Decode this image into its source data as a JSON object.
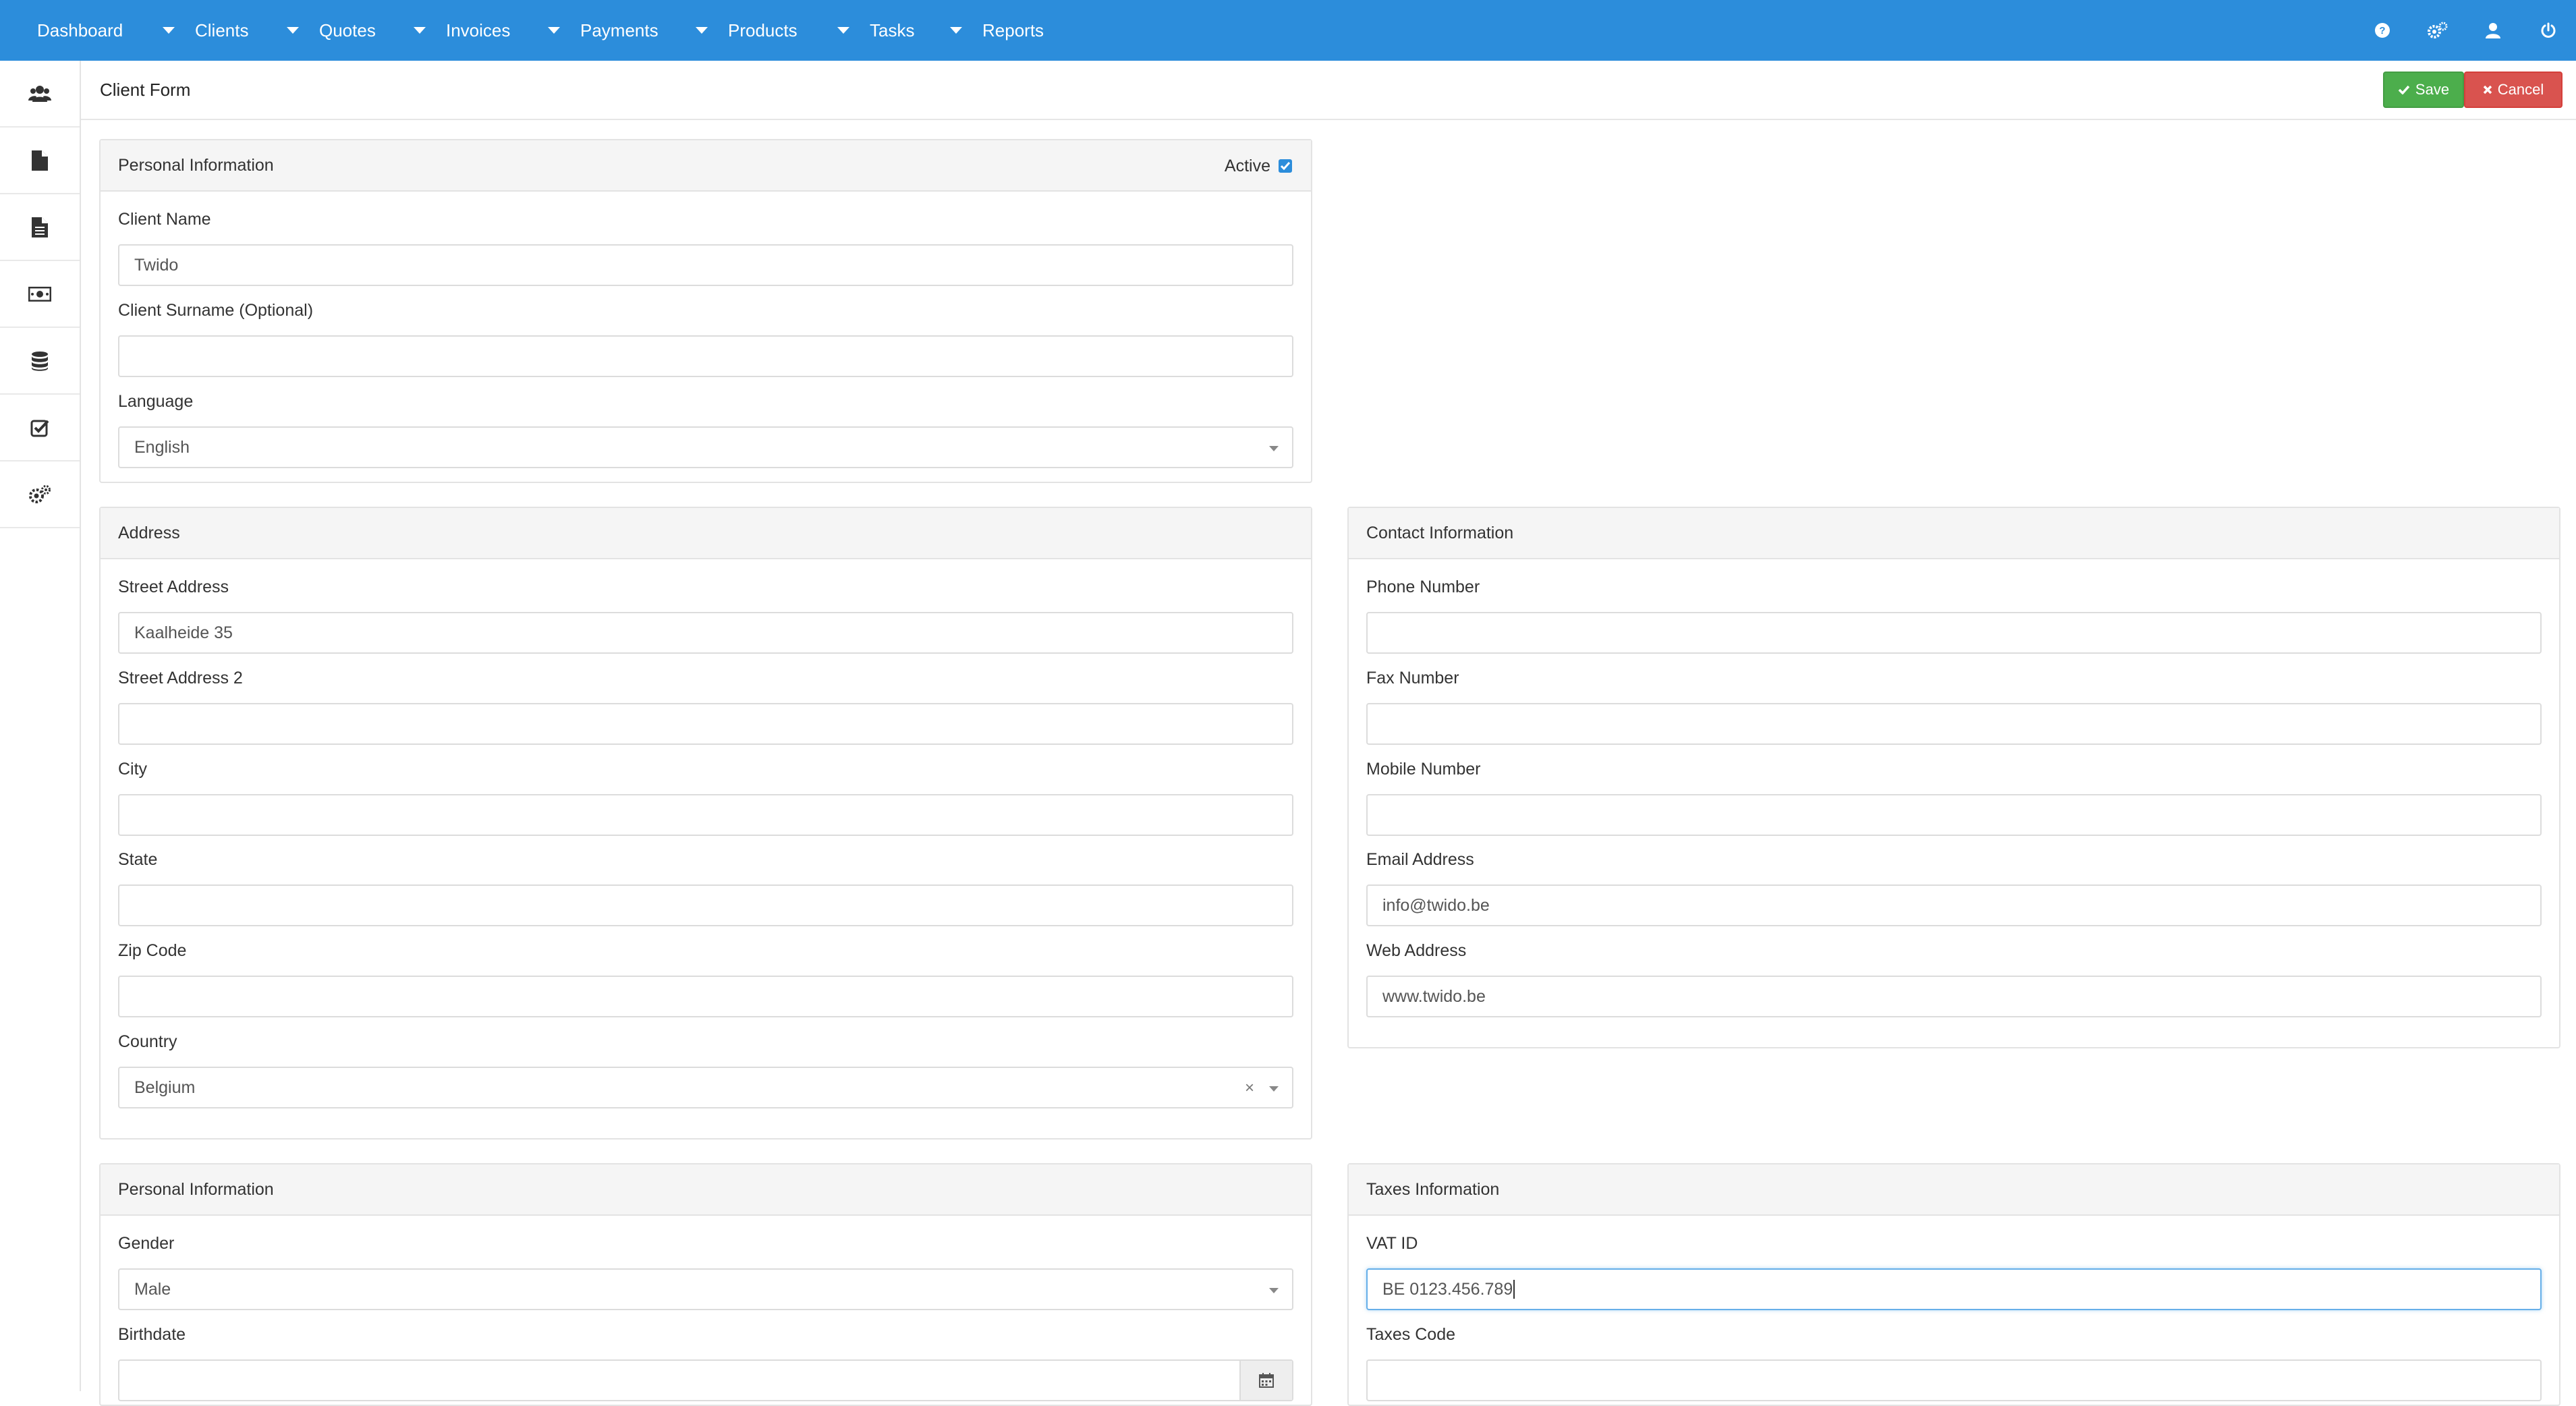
{
  "nav": {
    "items": [
      {
        "label": "Dashboard",
        "has_caret": false
      },
      {
        "label": "Clients",
        "has_caret": true
      },
      {
        "label": "Quotes",
        "has_caret": true
      },
      {
        "label": "Invoices",
        "has_caret": true
      },
      {
        "label": "Payments",
        "has_caret": true
      },
      {
        "label": "Products",
        "has_caret": true
      },
      {
        "label": "Tasks",
        "has_caret": true
      },
      {
        "label": "Reports",
        "has_caret": true
      }
    ],
    "right_icons": [
      "question-circle-icon",
      "cogs-icon",
      "user-icon",
      "power-off-icon"
    ]
  },
  "sidebar": {
    "icons": [
      "users-icon",
      "file-icon",
      "file-text-icon",
      "money-icon",
      "database-icon",
      "check-square-icon",
      "cogs-icon"
    ]
  },
  "header": {
    "title": "Client Form",
    "save_label": "Save",
    "cancel_label": "Cancel"
  },
  "personal": {
    "title": "Personal Information",
    "active_label": "Active",
    "active_checked": true,
    "client_name_label": "Client Name",
    "client_name_value": "Twido",
    "surname_label": "Client Surname (Optional)",
    "surname_value": "",
    "language_label": "Language",
    "language_value": "English"
  },
  "address": {
    "title": "Address",
    "street_label": "Street Address",
    "street_value": "Kaalheide 35",
    "street2_label": "Street Address 2",
    "street2_value": "",
    "city_label": "City",
    "city_value": "",
    "state_label": "State",
    "state_value": "",
    "zip_label": "Zip Code",
    "zip_value": "",
    "country_label": "Country",
    "country_value": "Belgium",
    "clear_symbol": "×"
  },
  "contact": {
    "title": "Contact Information",
    "phone_label": "Phone Number",
    "phone_value": "",
    "fax_label": "Fax Number",
    "fax_value": "",
    "mobile_label": "Mobile Number",
    "mobile_value": "",
    "email_label": "Email Address",
    "email_value": "info@twido.be",
    "web_label": "Web Address",
    "web_value": "www.twido.be"
  },
  "personal2": {
    "title": "Personal Information",
    "gender_label": "Gender",
    "gender_value": "Male",
    "birthdate_label": "Birthdate",
    "birthdate_value": ""
  },
  "taxes": {
    "title": "Taxes Information",
    "vat_label": "VAT ID",
    "vat_value": "BE 0123.456.789",
    "taxcode_label": "Taxes Code",
    "taxcode_value": ""
  },
  "colors": {
    "nav_bg": "#2c8ddb",
    "save_bg": "#4cae4c",
    "cancel_bg": "#d9534f"
  }
}
